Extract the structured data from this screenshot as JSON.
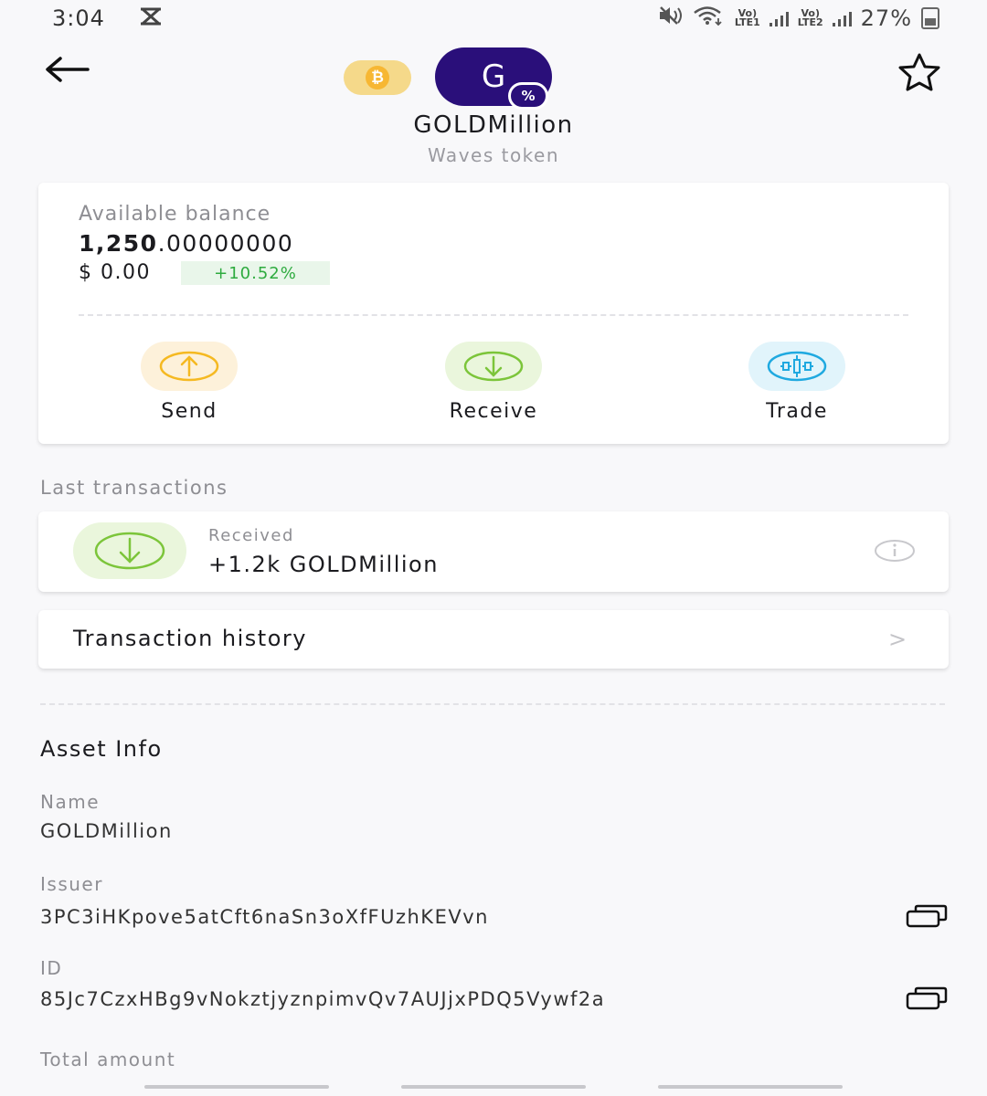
{
  "status_bar": {
    "time": "3:04",
    "sim1_label_top": "Vo)",
    "sim1_label_bottom": "LTE1",
    "sim2_label_top": "Vo)",
    "sim2_label_bottom": "LTE2",
    "battery": "27%"
  },
  "header": {
    "token_initial": "G",
    "token_badge": "%",
    "btc_symbol": "₿",
    "token_name": "GOLDMillion",
    "token_type": "Waves token"
  },
  "balance": {
    "label": "Available balance",
    "amount_int": "1,250",
    "amount_dec": ".00000000",
    "usd": "$ 0.00",
    "change": "+10.52%"
  },
  "actions": [
    {
      "label": "Send",
      "icon": "arrow-up-circle-icon",
      "color": "#f5b921",
      "bg": "#fdf1da"
    },
    {
      "label": "Receive",
      "icon": "arrow-down-circle-icon",
      "color": "#7cc53a",
      "bg": "#eaf6dc"
    },
    {
      "label": "Trade",
      "icon": "candlestick-icon",
      "color": "#1fa9e0",
      "bg": "#e1f4fb"
    }
  ],
  "transactions": {
    "title": "Last transactions",
    "items": [
      {
        "status": "Received",
        "amount": "+1.2k GOLDMillion"
      }
    ],
    "history_label": "Transaction history",
    "history_chevron": ">"
  },
  "asset_info": {
    "title": "Asset Info",
    "name_label": "Name",
    "name_value": "GOLDMillion",
    "issuer_label": "Issuer",
    "issuer_value": "3PC3iHKpove5atCft6naSn3oXfFUzhKEVvn",
    "id_label": "ID",
    "id_value": "85Jc7CzxHBg9vNokztjyznpimvQv7AUJjxPDQ5Vywf2a",
    "total_label": "Total amount"
  },
  "colors": {
    "token_bg": "#2a0f7a",
    "positive": "#2eab3f",
    "btc": "#f7b733"
  }
}
